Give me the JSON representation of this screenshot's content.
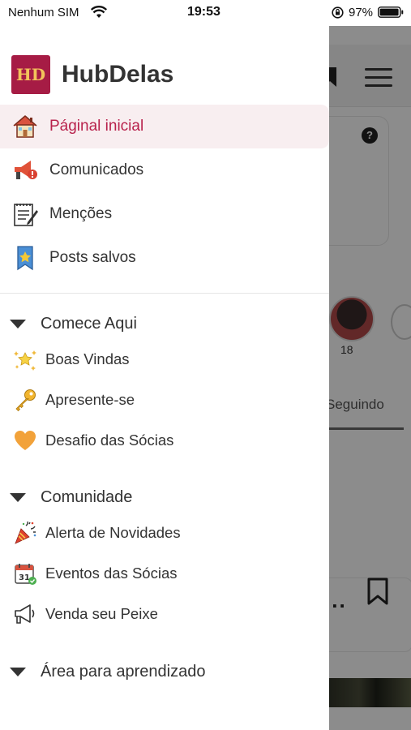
{
  "status_bar": {
    "carrier": "Nenhum SIM",
    "time": "19:53",
    "battery_percent": "97%",
    "icons": [
      "wifi-icon",
      "orientation-lock-icon",
      "battery-icon"
    ]
  },
  "brand": {
    "name": "HubDelas",
    "logo_text": "HD",
    "logo_color": "#a61c45"
  },
  "nav": {
    "items": [
      {
        "label": "Páginal inicial",
        "icon": "house-icon",
        "active": true
      },
      {
        "label": "Comunicados",
        "icon": "megaphone-icon",
        "active": false
      },
      {
        "label": "Menções",
        "icon": "notepad-icon",
        "active": false
      },
      {
        "label": "Posts salvos",
        "icon": "bookmark-star-icon",
        "active": false
      }
    ]
  },
  "sections": [
    {
      "title": "Comece Aqui",
      "channels": [
        {
          "label": "Boas Vindas",
          "icon": "sparkle-star-icon"
        },
        {
          "label": "Apresente-se",
          "icon": "key-icon"
        },
        {
          "label": "Desafio das Sócias",
          "icon": "heart-icon"
        }
      ]
    },
    {
      "title": "Comunidade",
      "channels": [
        {
          "label": "Alerta de Novidades",
          "icon": "party-popper-icon"
        },
        {
          "label": "Eventos das Sócias",
          "icon": "calendar-icon"
        },
        {
          "label": "Venda seu Peixe",
          "icon": "loudspeaker-icon"
        }
      ]
    },
    {
      "title": "Área para aprendizado",
      "channels": []
    }
  ],
  "background": {
    "follower_count": "18",
    "following_label": "Seguindo",
    "more_label": "..."
  },
  "colors": {
    "accent": "#b8224c",
    "active_bg": "#f8eef0"
  }
}
